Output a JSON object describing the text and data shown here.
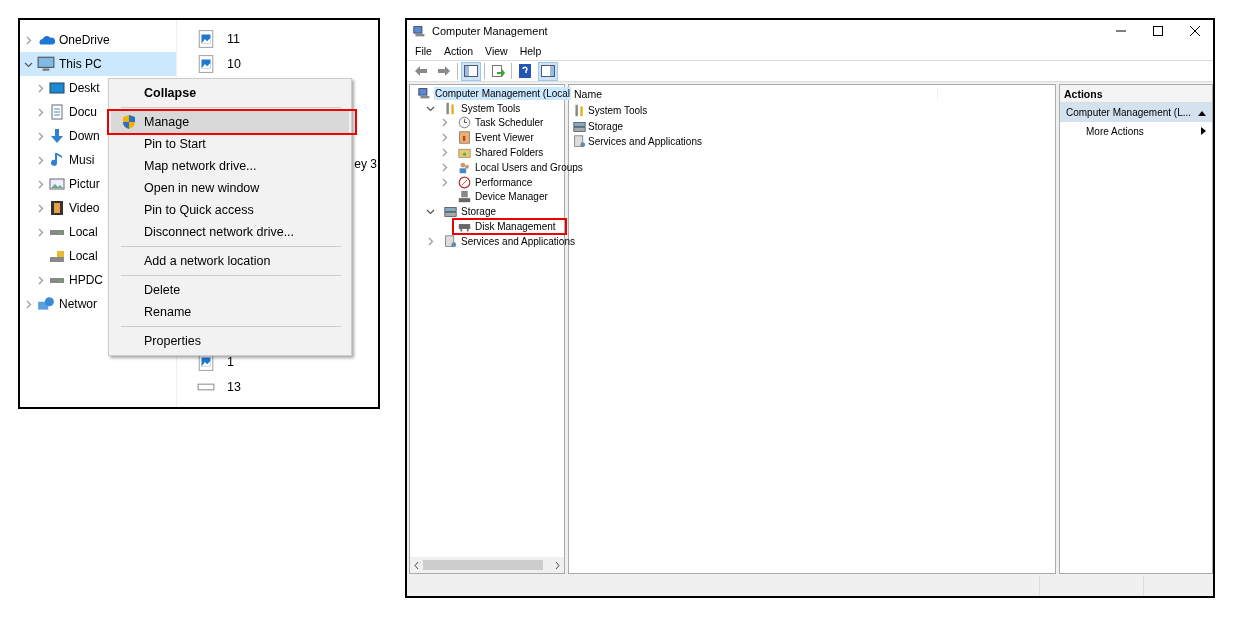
{
  "explorer": {
    "nav_items": [
      {
        "label": "OneDrive",
        "kind": "cloud",
        "has_children": true,
        "expanded": false,
        "selected": false
      },
      {
        "label": "This PC",
        "kind": "computer",
        "has_children": true,
        "expanded": true,
        "selected": true,
        "children": [
          {
            "label": "Deskt",
            "kind": "desktop",
            "has_children": true,
            "expanded": false,
            "selected": false
          },
          {
            "label": "Docu",
            "kind": "document",
            "has_children": true,
            "expanded": false,
            "selected": false
          },
          {
            "label": "Down",
            "kind": "download",
            "has_children": true,
            "expanded": false,
            "selected": false
          },
          {
            "label": "Musi",
            "kind": "music",
            "has_children": true,
            "expanded": false,
            "selected": false
          },
          {
            "label": "Pictur",
            "kind": "pictures",
            "has_children": true,
            "expanded": false,
            "selected": false
          },
          {
            "label": "Video",
            "kind": "video",
            "has_children": true,
            "expanded": false,
            "selected": false
          },
          {
            "label": "Local",
            "kind": "drive",
            "has_children": true,
            "expanded": false,
            "selected": false
          },
          {
            "label": "Local",
            "kind": "locked-drive",
            "has_children": false,
            "expanded": false,
            "selected": false
          },
          {
            "label": "HPDC",
            "kind": "drive",
            "has_children": true,
            "expanded": false,
            "selected": false
          }
        ]
      },
      {
        "label": "Networ",
        "kind": "network",
        "has_children": true,
        "expanded": false,
        "selected": false
      }
    ],
    "files_top": [
      {
        "name": "11",
        "kind": "image"
      },
      {
        "name": "10",
        "kind": "image"
      }
    ],
    "file_fragment": "ey 3",
    "files_bottom": [
      {
        "name": "1",
        "kind": "image"
      },
      {
        "name": "13",
        "kind": "blank"
      }
    ],
    "context_menu": {
      "groups": [
        [
          {
            "label": "Collapse",
            "kind": "default",
            "selected": false,
            "shield": false
          }
        ],
        [
          {
            "label": "Manage",
            "kind": "command",
            "selected": true,
            "annotated": true,
            "shield": true
          },
          {
            "label": "Pin to Start",
            "kind": "command",
            "selected": false,
            "shield": false
          },
          {
            "label": "Map network drive...",
            "kind": "command",
            "selected": false,
            "shield": false
          },
          {
            "label": "Open in new window",
            "kind": "command",
            "selected": false,
            "shield": false
          },
          {
            "label": "Pin to Quick access",
            "kind": "command",
            "selected": false,
            "shield": false
          },
          {
            "label": "Disconnect network drive...",
            "kind": "command",
            "selected": false,
            "shield": false
          }
        ],
        [
          {
            "label": "Add a network location",
            "kind": "command",
            "selected": false,
            "shield": false
          }
        ],
        [
          {
            "label": "Delete",
            "kind": "command",
            "selected": false,
            "shield": false
          },
          {
            "label": "Rename",
            "kind": "command",
            "selected": false,
            "shield": false
          }
        ],
        [
          {
            "label": "Properties",
            "kind": "command",
            "selected": false,
            "shield": false
          }
        ]
      ]
    }
  },
  "window": {
    "title": "Computer Management",
    "menu": [
      "File",
      "Action",
      "View",
      "Help"
    ],
    "tree": [
      {
        "label": "Computer Management (Local",
        "kind": "computer-management",
        "selected": true,
        "children": [
          {
            "label": "System Tools",
            "kind": "tools",
            "has_children": true,
            "expanded": true,
            "selected": false,
            "annotated": false,
            "children": [
              {
                "label": "Task Scheduler",
                "kind": "clock",
                "has_children": true,
                "expanded": false,
                "selected": false,
                "annotated": false
              },
              {
                "label": "Event Viewer",
                "kind": "event",
                "has_children": true,
                "expanded": false,
                "selected": false,
                "annotated": false
              },
              {
                "label": "Shared Folders",
                "kind": "shared",
                "has_children": true,
                "expanded": false,
                "selected": false,
                "annotated": false
              },
              {
                "label": "Local Users and Groups",
                "kind": "users",
                "has_children": true,
                "expanded": false,
                "selected": false,
                "annotated": false
              },
              {
                "label": "Performance",
                "kind": "performance",
                "has_children": true,
                "expanded": false,
                "selected": false,
                "annotated": false
              },
              {
                "label": "Device Manager",
                "kind": "device",
                "has_children": false,
                "expanded": false,
                "selected": false,
                "annotated": false
              }
            ]
          },
          {
            "label": "Storage",
            "kind": "storage",
            "has_children": true,
            "expanded": true,
            "selected": false,
            "annotated": false,
            "children": [
              {
                "label": "Disk Management",
                "kind": "disk",
                "has_children": false,
                "expanded": false,
                "selected": false,
                "annotated": true
              }
            ]
          },
          {
            "label": "Services and Applications",
            "kind": "services",
            "has_children": true,
            "expanded": false,
            "selected": false,
            "annotated": false
          }
        ]
      }
    ],
    "list": {
      "column": "Name",
      "items": [
        {
          "label": "System Tools",
          "kind": "tools"
        },
        {
          "label": "Storage",
          "kind": "storage"
        },
        {
          "label": "Services and Applications",
          "kind": "services"
        }
      ]
    },
    "actions": {
      "title": "Actions",
      "section": "Computer Management (L...",
      "items": [
        "More Actions"
      ]
    }
  }
}
